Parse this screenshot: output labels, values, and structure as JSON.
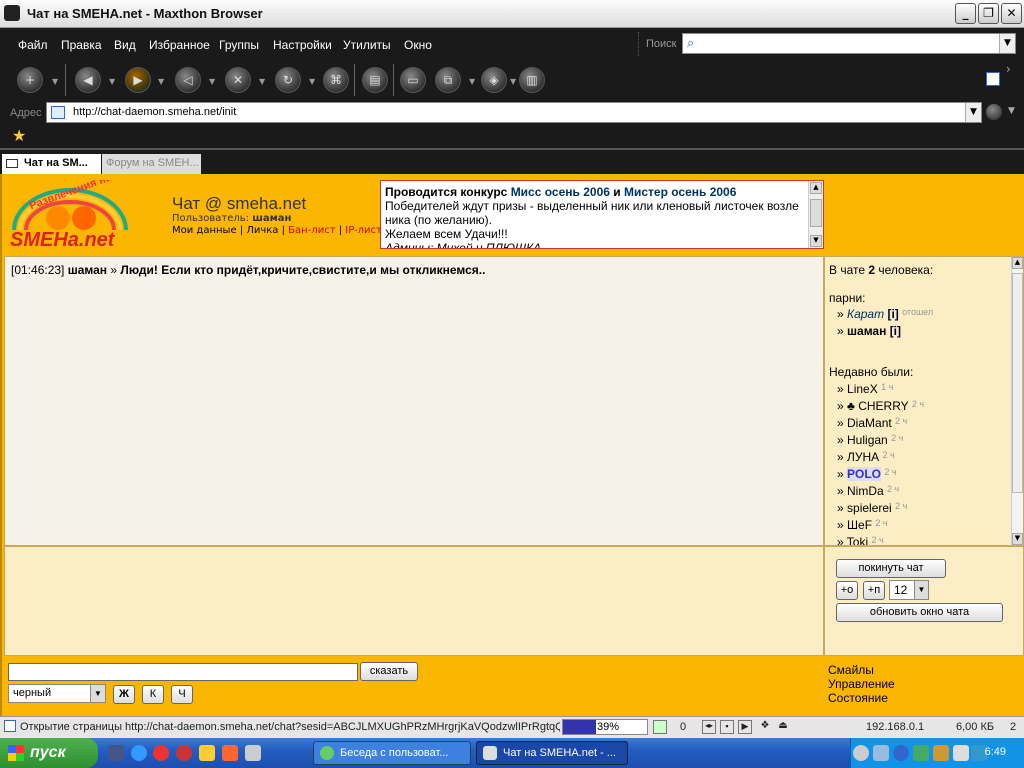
{
  "window": {
    "title": "Чат на SMEHA.net - Maxthon Browser"
  },
  "menu": [
    "Файл",
    "Правка",
    "Вид",
    "Избранное",
    "Группы",
    "Настройки",
    "Утилиты",
    "Окно"
  ],
  "search": {
    "label": "Поиск",
    "value": ""
  },
  "address": {
    "label": "Адрес",
    "url": "http://chat-daemon.smeha.net/init"
  },
  "tabs": [
    {
      "label": "Чат на SM...",
      "active": true
    },
    {
      "label": "Форум на SMEH...",
      "active": false
    }
  ],
  "chat": {
    "title": "Чат @ smeha.net",
    "user_label": "Пользователь:",
    "user_name": "шаман",
    "links": [
      "Мои данные",
      "Личка",
      "Бан-лист",
      "IP-лист"
    ],
    "notice": {
      "line1_a": "Проводится конкурс ",
      "line1_b": "Мисс осень 2006",
      "line1_c": " и ",
      "line1_d": "Мистер осень 2006",
      "line2": "Победителей ждут призы - выделенный ник или кленовый листочек возле ника (по желанию).",
      "line3": "Желаем всем Удачи!!!",
      "line4": "Админы: Михей и ПЛЮШКА"
    },
    "messages": [
      {
        "time": "[01:46:23]",
        "user": "шаман",
        "text": "Люди! Если кто придёт,кричите,свистите,и мы откликнемся.."
      }
    ]
  },
  "users": {
    "count_prefix": "В чате ",
    "count": "2",
    "count_suffix": " человека:",
    "boys_label": "парни:",
    "online": [
      {
        "name": "Карат",
        "tag": "[i]",
        "status": "отошел"
      },
      {
        "name": "шаман",
        "tag": "[i]",
        "status": ""
      }
    ],
    "recent_label": "Недавно были:",
    "recent": [
      {
        "name": "LineX",
        "ago": "1 ч"
      },
      {
        "name": "♣ CHERRY",
        "ago": "2 ч"
      },
      {
        "name": "DiaMant",
        "ago": "2 ч"
      },
      {
        "name": "Huligan",
        "ago": "2 ч"
      },
      {
        "name": "ЛУНА",
        "ago": "2 ч"
      },
      {
        "name": "POLO",
        "ago": "2 ч"
      },
      {
        "name": "NimDa",
        "ago": "2 ч"
      },
      {
        "name": "spielerei",
        "ago": "2 ч"
      },
      {
        "name": "ШеF",
        "ago": "2 ч"
      },
      {
        "name": "Toki",
        "ago": "2 ч"
      }
    ]
  },
  "controls": {
    "leave": "покинуть чат",
    "font_up": "+о",
    "font_dn": "+п",
    "font_size": "12",
    "refresh": "обновить окно чата"
  },
  "input": {
    "send": "сказать",
    "color": "черный",
    "bold": "Ж",
    "italic": "К",
    "underline": "Ч"
  },
  "footer_links": [
    "Смайлы",
    "Управление",
    "Состояние"
  ],
  "status": {
    "text": "Открытие страницы http://chat-daemon.smeha.net/chat?sesid=ABCJLMXUGhPRzMHrgrjKaVQodzwlIPrRgtqQof",
    "progress": "39%",
    "progress_value": 0.39,
    "count": "0",
    "ip": "192.168.0.1",
    "size": "6,00 КБ",
    "num": "2"
  },
  "taskbar": {
    "start": "пуск",
    "items": [
      "Беседа с пользоват...",
      "Чат на SMEHA.net - ..."
    ],
    "clock": "6:49"
  },
  "colors": {
    "accent": "#fbb700",
    "panel": "#fbedc4",
    "dark": "#1a1a1a"
  }
}
